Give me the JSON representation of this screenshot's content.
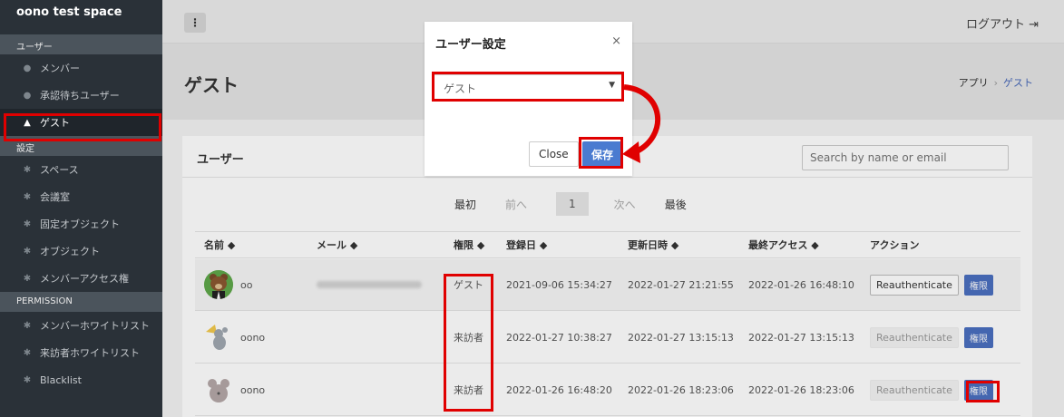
{
  "sidebar": {
    "brand": "oono test space",
    "sections": {
      "users": "ユーザー",
      "settings": "設定",
      "permission": "PERMISSION"
    },
    "items": {
      "members": "メンバー",
      "pending": "承認待ちユーザー",
      "guests": "ゲスト",
      "spaces": "スペース",
      "meeting_rooms": "会議室",
      "fixed_objects": "固定オブジェクト",
      "objects": "オブジェクト",
      "member_access": "メンバーアクセス権",
      "member_whitelist": "メンバーホワイトリスト",
      "visitor_whitelist": "来訪者ホワイトリスト",
      "blacklist": "Blacklist"
    }
  },
  "topbar": {
    "menu_icon": "⋮",
    "logout": "ログアウト"
  },
  "header": {
    "title": "ゲスト",
    "breadcrumb_app": "アプリ",
    "breadcrumb_current": "ゲスト"
  },
  "card": {
    "title": "ユーザー",
    "search_placeholder": "Search by name or email"
  },
  "pager": {
    "first": "最初",
    "prev": "前へ",
    "page": "1",
    "next": "次へ",
    "last": "最後"
  },
  "table": {
    "headers": {
      "name": "名前 ◆",
      "mail": "メール ◆",
      "role": "権限 ◆",
      "registered": "登録日 ◆",
      "updated": "更新日時 ◆",
      "last_access": "最終アクセス ◆",
      "action": "アクション"
    },
    "rows": [
      {
        "name": "oo",
        "role": "ゲスト",
        "registered": "2021-09-06 15:34:27",
        "updated": "2022-01-27 21:21:55",
        "last_access": "2022-01-26 16:48:10",
        "reauth": "Reauthenticate",
        "perm": "権限"
      },
      {
        "name": "oono",
        "role": "来訪者",
        "registered": "2022-01-27 10:38:27",
        "updated": "2022-01-27 13:15:13",
        "last_access": "2022-01-27 13:15:13",
        "reauth": "Reauthenticate",
        "perm": "権限"
      },
      {
        "name": "oono",
        "role": "来訪者",
        "registered": "2022-01-26 16:48:20",
        "updated": "2022-01-26 18:23:06",
        "last_access": "2022-01-26 18:23:06",
        "reauth": "Reauthenticate",
        "perm": "権限"
      }
    ]
  },
  "modal": {
    "title": "ユーザー設定",
    "close_icon": "×",
    "select_value": "ゲスト",
    "cancel": "Close",
    "save": "保存"
  },
  "colors": {
    "highlight": "#e00000",
    "sidebar_bg": "#2a3138",
    "accent": "#4a7bd0"
  }
}
